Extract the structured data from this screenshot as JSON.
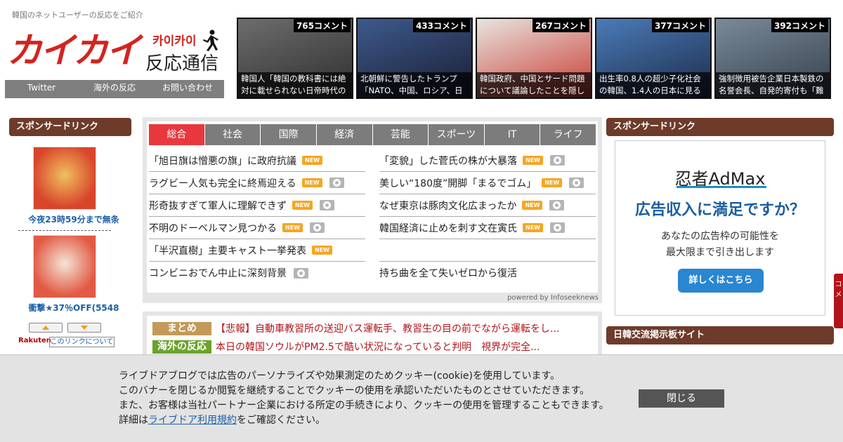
{
  "header": {
    "tagline": "韓国のネットユーザーの反応をご紹介",
    "logo_main": "カイカイ",
    "logo_kana": "카이카이",
    "logo_sub": "反応通信",
    "nav": [
      "Twitter",
      "海外の反応",
      "お問い合わせ"
    ]
  },
  "thumbs": [
    {
      "count": "765コメント",
      "caption": "韓国人「韓国の教科書には絶対に載せられない日帝時代の",
      "colors": [
        "#6d6d6d",
        "#2e2e2e"
      ]
    },
    {
      "count": "433コメント",
      "caption": "北朝鮮に警告したトランプ「NATO、中国、ロシア、日",
      "colors": [
        "#3d5a8c",
        "#1a1d33"
      ]
    },
    {
      "count": "267コメント",
      "caption": "韓国政府、中国とサード問題について議論したことを隠し",
      "colors": [
        "#e8e4df",
        "#c93a32"
      ]
    },
    {
      "count": "377コメント",
      "caption": "出生率0.8人の超少子化社会の韓国、1.4人の日本に見る",
      "colors": [
        "#4b7bb8",
        "#1c2c4a"
      ]
    },
    {
      "count": "392コメント",
      "caption": "強制徴用被告企業日本製鉄の名誉会長、自発的寄付も「難",
      "colors": [
        "#7a8a9a",
        "#34404c"
      ]
    }
  ],
  "left_sidebar": {
    "title": "スポンサードリンク",
    "products": [
      {
        "label": "今夜23時59分まで無条",
        "colors": [
          "#d9452b",
          "#f0c060"
        ]
      },
      {
        "label": "衝撃★37％OFF(5548",
        "colors": [
          "#e25a43",
          "#f4e5d8"
        ]
      }
    ],
    "rakuten": "Rakuten",
    "about": "このリンクについて"
  },
  "news": {
    "tabs": [
      "総合",
      "社会",
      "国際",
      "経済",
      "芸能",
      "スポーツ",
      "IT",
      "ライフ"
    ],
    "active_tab": 0,
    "new_label": "NEW",
    "left_items": [
      {
        "title": "「旭日旗は憎悪の旗」に政府抗議",
        "new": true,
        "photo": false
      },
      {
        "title": "ラグビー人気も完全に終焉迎える",
        "new": true,
        "photo": true
      },
      {
        "title": "形奇抜すぎて軍人に理解できず",
        "new": true,
        "photo": true
      },
      {
        "title": "不明のドーベルマン見つかる",
        "new": true,
        "photo": true
      },
      {
        "title": "「半沢直樹」主要キャスト一挙発表",
        "new": true,
        "photo": false
      },
      {
        "title": "コンビニおでん中止に深刻背景",
        "new": false,
        "photo": true
      }
    ],
    "right_items": [
      {
        "title": "「変貌」した菅氏の株が大暴落",
        "new": true,
        "photo": true
      },
      {
        "title": "美しい“180度”開脚「まるでゴム」",
        "new": true,
        "photo": true
      },
      {
        "title": "なぜ東京は豚肉文化広まったか",
        "new": true,
        "photo": true
      },
      {
        "title": "韓国経済に止めを刺す文在寅氏",
        "new": true,
        "photo": true
      },
      {
        "title": "",
        "new": false,
        "photo": false
      },
      {
        "title": "持ち曲を全て失いゼロから復活",
        "new": false,
        "photo": false
      }
    ],
    "powered": "powered by Infoseeknews"
  },
  "matome": [
    {
      "tag": "まとめ",
      "color": "#c39a59",
      "text": "【悲報】自動車教習所の送迎バス運転手、教習生の目の前でながら運転をし..."
    },
    {
      "tag": "海外の反応",
      "color": "#6aa329",
      "text": "本日の韓国ソウルがPM2.5で酷い状況になっていると判明　視界が完全..."
    }
  ],
  "right_sidebar": {
    "title": "スポンサードリンク",
    "ad": {
      "brand": "忍者AdMax",
      "headline": "広告収入に満足ですか？",
      "body1": "あなたの広告枠の可能性を",
      "body2": "最大限まで引き出します",
      "cta": "詳しくはこちら"
    },
    "title2": "日韓交流掲示板サイト",
    "edge_tab": "コメ"
  },
  "cookie": {
    "line1": "ライブドアブログでは広告のパーソナライズや効果測定のためクッキー(cookie)を使用しています。",
    "line2": "このバナーを閉じるか閲覧を継続することでクッキーの使用を承認いただいたものとさせていただきます。",
    "line3": "また、お客様は当社パートナー企業における所定の手続きにより、クッキーの使用を管理することもできます。",
    "line4_prefix": "詳細は",
    "link": "ライブドア利用規約",
    "line4_suffix": "をご確認ください。",
    "close": "閉じる"
  }
}
